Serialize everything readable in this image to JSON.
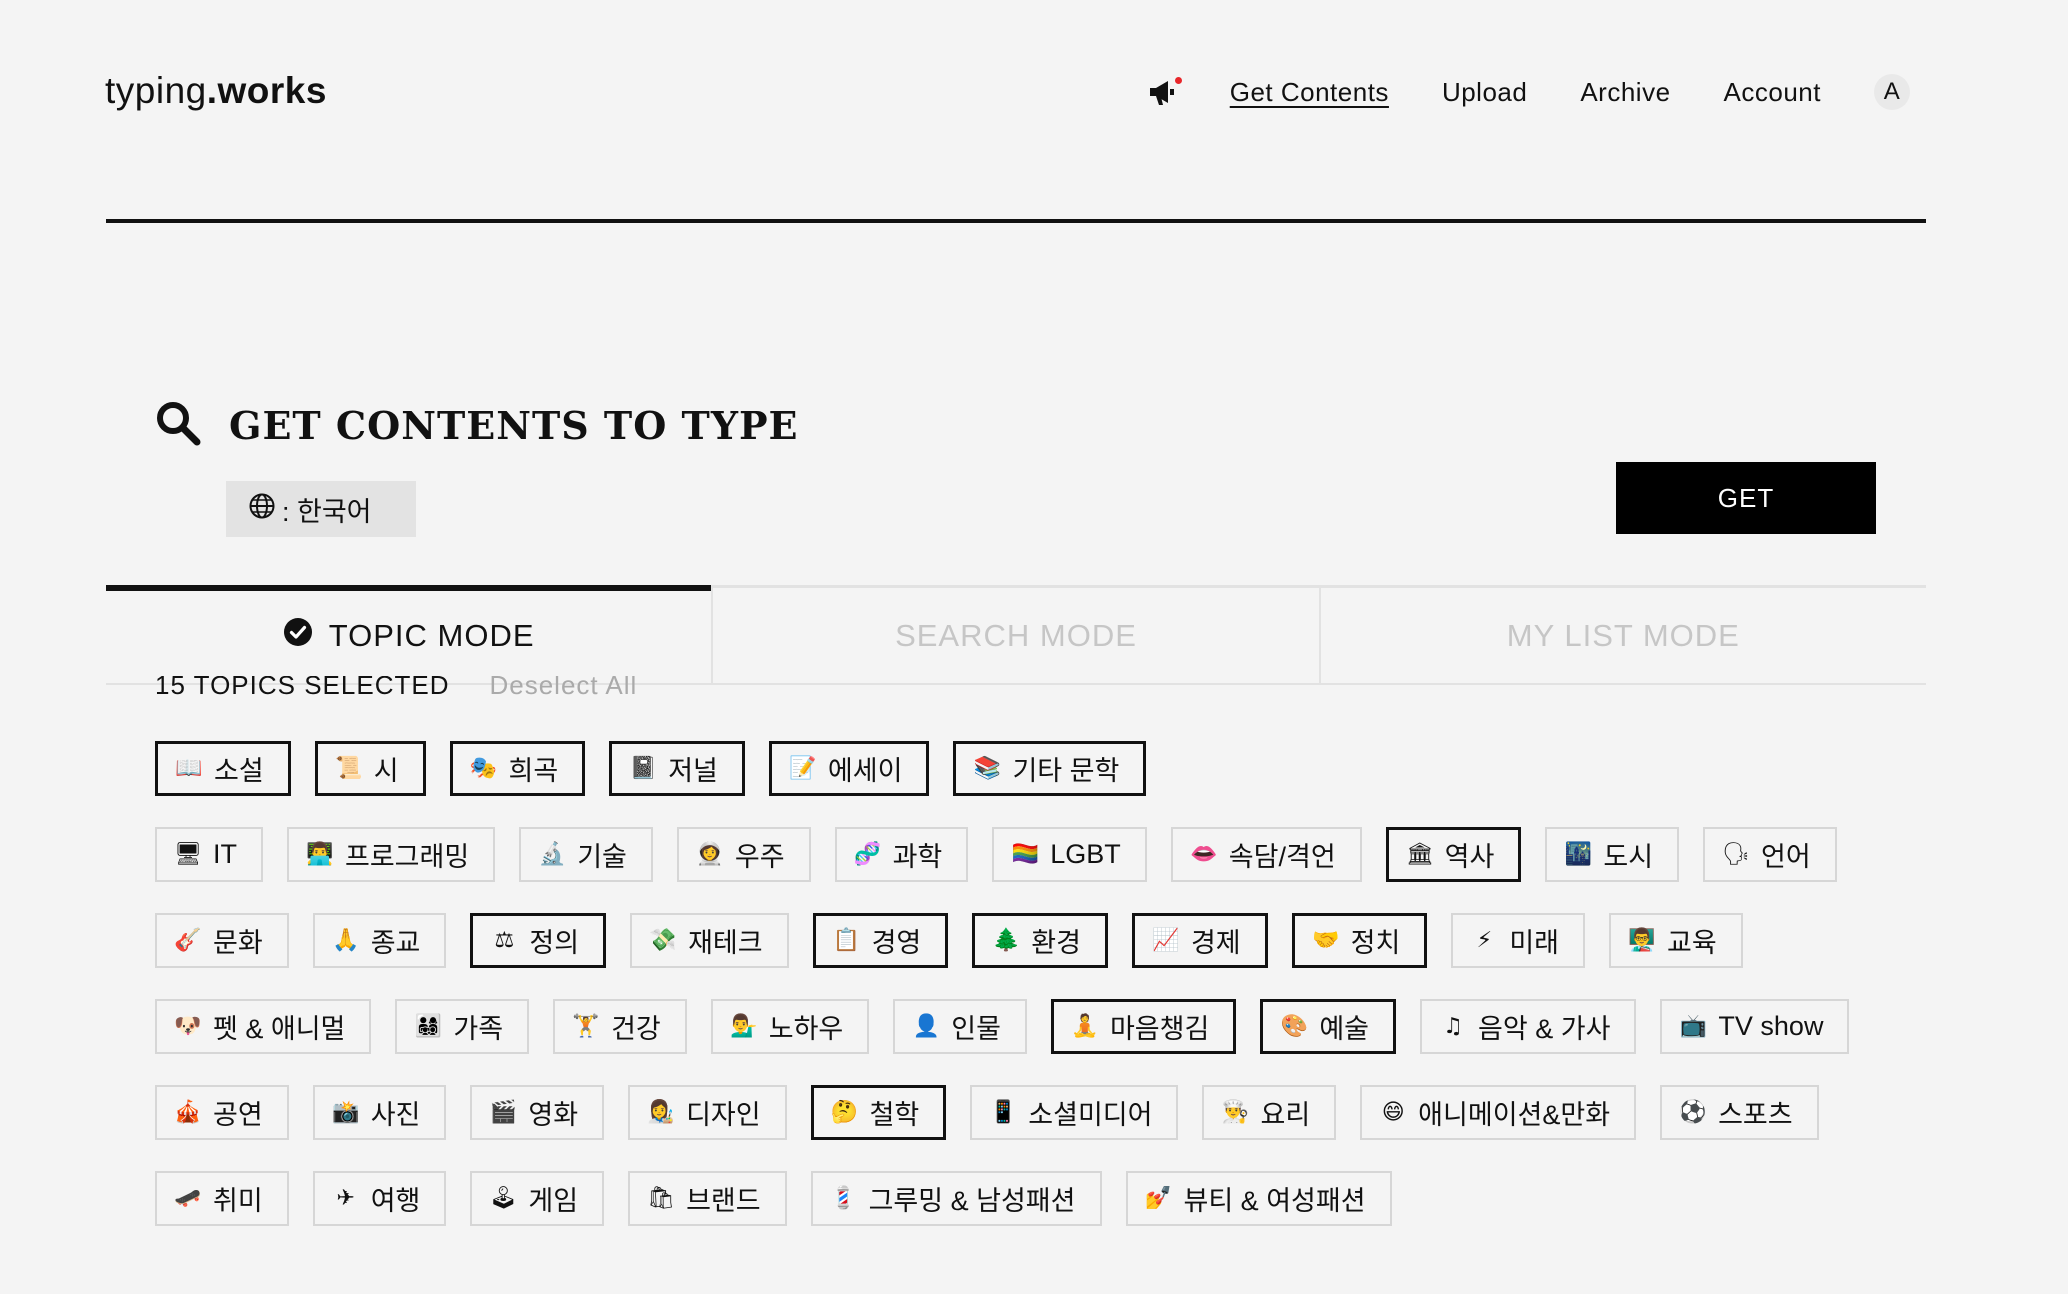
{
  "header": {
    "logo_regular": "typing",
    "logo_bold": ".works",
    "nav": [
      {
        "label": "Get Contents",
        "active": true
      },
      {
        "label": "Upload",
        "active": false
      },
      {
        "label": "Archive",
        "active": false
      },
      {
        "label": "Account",
        "active": false
      }
    ],
    "avatar_letter": "A"
  },
  "get_contents": {
    "title": "GET CONTENTS TO TYPE",
    "language_label": ": 한국어",
    "get_button": "GET"
  },
  "tabs": [
    {
      "label": "TOPIC MODE",
      "active": true
    },
    {
      "label": "SEARCH MODE",
      "active": false
    },
    {
      "label": "MY LIST MODE",
      "active": false
    }
  ],
  "selection": {
    "count_text": "15 TOPICS SELECTED",
    "deselect_text": "Deselect All"
  },
  "topics": [
    [
      {
        "emoji": "📖",
        "label": "소설",
        "selected": true
      },
      {
        "emoji": "📜",
        "label": "시",
        "selected": true
      },
      {
        "emoji": "🎭",
        "label": "희곡",
        "selected": true
      },
      {
        "emoji": "📓",
        "label": "저널",
        "selected": true
      },
      {
        "emoji": "📝",
        "label": "에세이",
        "selected": true
      },
      {
        "emoji": "📚",
        "label": "기타 문학",
        "selected": true
      }
    ],
    [
      {
        "emoji": "🖥",
        "label": "IT",
        "selected": false
      },
      {
        "emoji": "👨‍💻",
        "label": "프로그래밍",
        "selected": false
      },
      {
        "emoji": "🔬",
        "label": "기술",
        "selected": false
      },
      {
        "emoji": "👩‍🚀",
        "label": "우주",
        "selected": false
      },
      {
        "emoji": "🧬",
        "label": "과학",
        "selected": false
      },
      {
        "emoji": "🏳️‍🌈",
        "label": "LGBT",
        "selected": false
      },
      {
        "emoji": "👄",
        "label": "속담/격언",
        "selected": false
      },
      {
        "emoji": "🏛",
        "label": "역사",
        "selected": true
      },
      {
        "emoji": "🌃",
        "label": "도시",
        "selected": false
      },
      {
        "emoji": "🗣",
        "label": "언어",
        "selected": false
      }
    ],
    [
      {
        "emoji": "🎸",
        "label": "문화",
        "selected": false
      },
      {
        "emoji": "🙏",
        "label": "종교",
        "selected": false
      },
      {
        "emoji": "⚖",
        "label": "정의",
        "selected": true
      },
      {
        "emoji": "💸",
        "label": "재테크",
        "selected": false
      },
      {
        "emoji": "📋",
        "label": "경영",
        "selected": true
      },
      {
        "emoji": "🌲",
        "label": "환경",
        "selected": true
      },
      {
        "emoji": "📈",
        "label": "경제",
        "selected": true
      },
      {
        "emoji": "🤝",
        "label": "정치",
        "selected": true
      },
      {
        "emoji": "⚡",
        "label": "미래",
        "selected": false
      },
      {
        "emoji": "👨‍🏫",
        "label": "교육",
        "selected": false
      }
    ],
    [
      {
        "emoji": "🐶",
        "label": "펫 & 애니멀",
        "selected": false
      },
      {
        "emoji": "👨‍👩‍👧‍👦",
        "label": "가족",
        "selected": false
      },
      {
        "emoji": "🏋",
        "label": "건강",
        "selected": false
      },
      {
        "emoji": "💁‍♂️",
        "label": "노하우",
        "selected": false
      },
      {
        "emoji": "👤",
        "label": "인물",
        "selected": false
      },
      {
        "emoji": "🧘",
        "label": "마음챙김",
        "selected": true
      },
      {
        "emoji": "🎨",
        "label": "예술",
        "selected": true
      },
      {
        "emoji": "♫",
        "label": "음악 & 가사",
        "selected": false
      },
      {
        "emoji": "📺",
        "label": "TV show",
        "selected": false
      }
    ],
    [
      {
        "emoji": "🎪",
        "label": "공연",
        "selected": false
      },
      {
        "emoji": "📸",
        "label": "사진",
        "selected": false
      },
      {
        "emoji": "🎬",
        "label": "영화",
        "selected": false
      },
      {
        "emoji": "👩‍🎨",
        "label": "디자인",
        "selected": false
      },
      {
        "emoji": "🤔",
        "label": "철학",
        "selected": true
      },
      {
        "emoji": "📱",
        "label": "소셜미디어",
        "selected": false
      },
      {
        "emoji": "👨‍🍳",
        "label": "요리",
        "selected": false
      },
      {
        "emoji": "😄",
        "label": "애니메이션&만화",
        "selected": false
      },
      {
        "emoji": "⚽",
        "label": "스포츠",
        "selected": false
      }
    ],
    [
      {
        "emoji": "🛹",
        "label": "취미",
        "selected": false
      },
      {
        "emoji": "✈",
        "label": "여행",
        "selected": false
      },
      {
        "emoji": "🕹",
        "label": "게임",
        "selected": false
      },
      {
        "emoji": "🛍",
        "label": "브랜드",
        "selected": false
      },
      {
        "emoji": "💈",
        "label": "그루밍 & 남성패션",
        "selected": false
      },
      {
        "emoji": "💅",
        "label": "뷰티 & 여성패션",
        "selected": false
      }
    ]
  ]
}
